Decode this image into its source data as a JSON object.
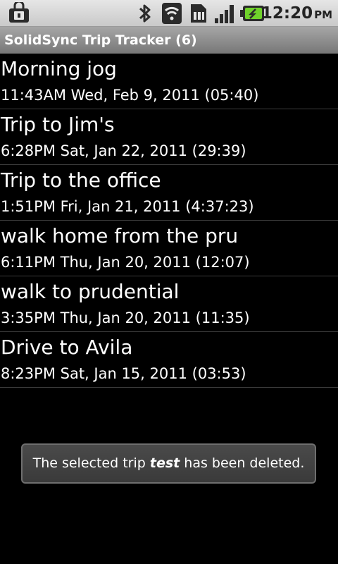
{
  "status_bar": {
    "time": "12:20",
    "ampm": "PM",
    "icons": [
      "notification-icon",
      "bluetooth-icon",
      "wifi-icon",
      "data-icon",
      "signal-icon",
      "battery-icon"
    ]
  },
  "title_bar": {
    "title": "SolidSync Trip Tracker (6)"
  },
  "trips": [
    {
      "name": "Morning jog",
      "time": "11:43AM Wed, Feb 9, 2011 (05:40)"
    },
    {
      "name": "Trip to Jim's",
      "time": "6:28PM Sat, Jan 22, 2011 (29:39)"
    },
    {
      "name": "Trip to the office",
      "time": "1:51PM Fri, Jan 21, 2011 (4:37:23)"
    },
    {
      "name": "walk home from the pru",
      "time": "6:11PM Thu, Jan 20, 2011 (12:07)"
    },
    {
      "name": "walk to prudential",
      "time": "3:35PM Thu, Jan 20, 2011 (11:35)"
    },
    {
      "name": "Drive to Avila",
      "time": "8:23PM Sat, Jan 15, 2011 (03:53)"
    }
  ],
  "toast": {
    "prefix": "The selected trip ",
    "trip_name": "test",
    "suffix": " has been deleted."
  },
  "colors": {
    "battery_charge": "#6fd12b",
    "background": "#000000",
    "title_bar": "#8f8f8f"
  }
}
